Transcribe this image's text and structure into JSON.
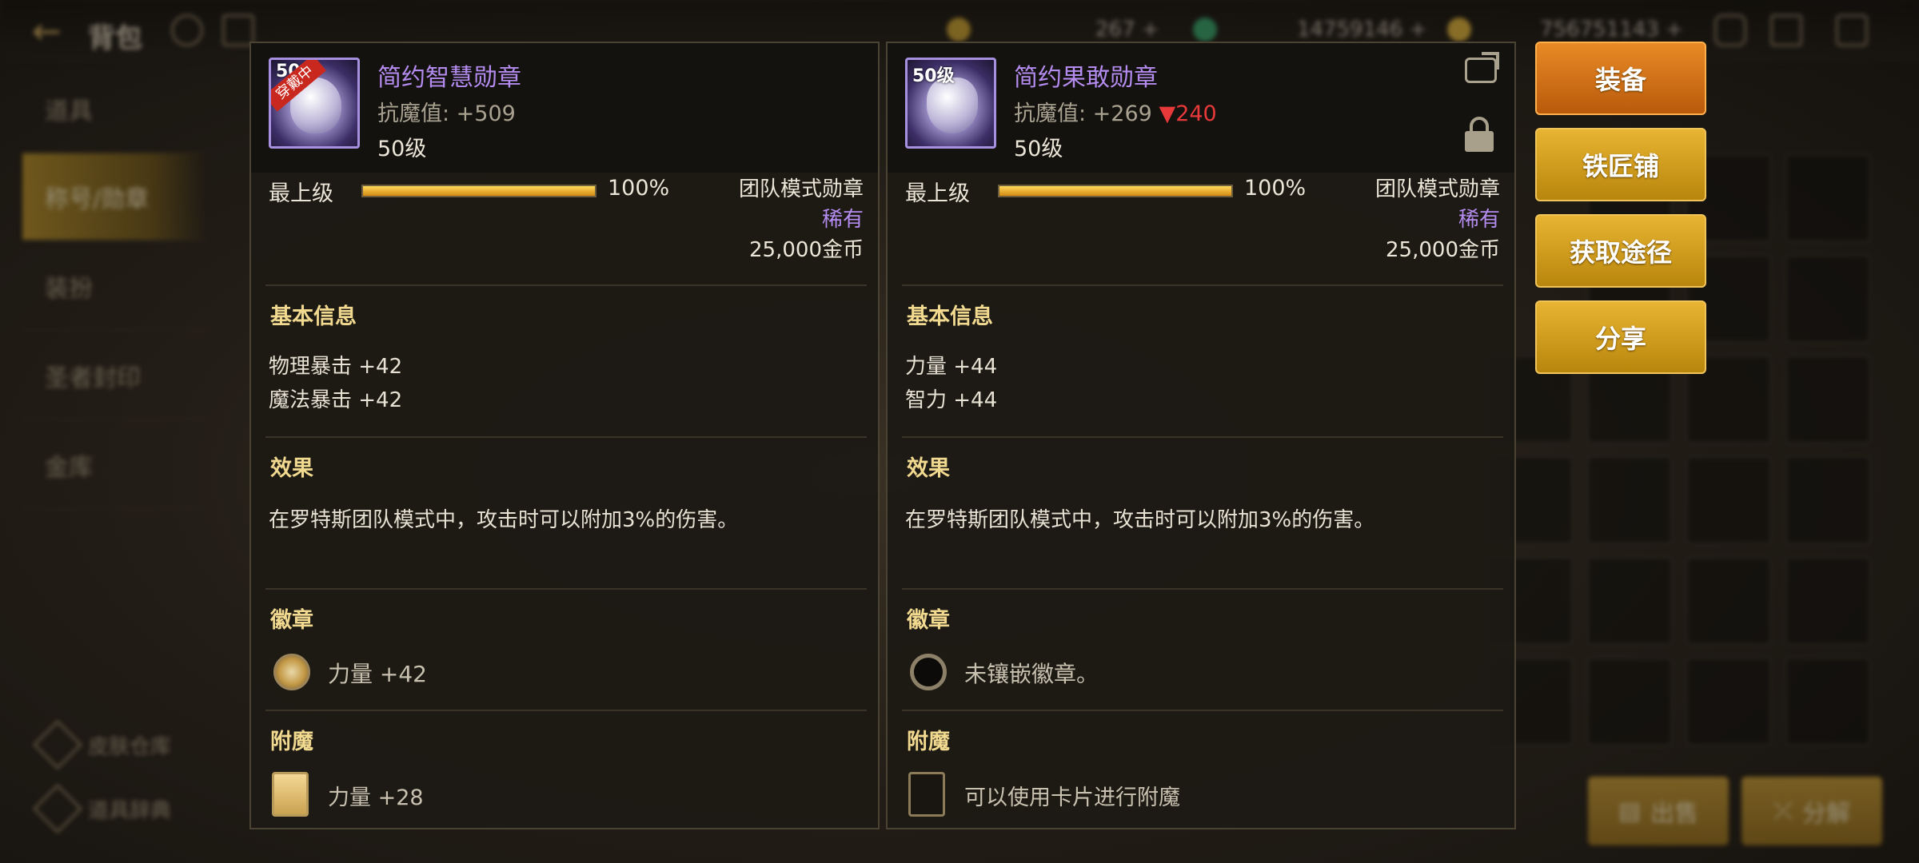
{
  "top_bar": {
    "back_label": "背包",
    "currency_1": "267 +",
    "currency_2": "14759146 +",
    "currency_3": "756751143 +"
  },
  "sidebar": {
    "items": [
      {
        "label": "道具"
      },
      {
        "label": "称号/勋章"
      },
      {
        "label": "装扮"
      },
      {
        "label": "圣者封印"
      },
      {
        "label": "金库"
      }
    ],
    "bottom": [
      {
        "label": "皮肤仓库"
      },
      {
        "label": "道具辞典"
      }
    ]
  },
  "bottom_buttons": {
    "sell": "出售",
    "decompose": "分解"
  },
  "panels": [
    {
      "name": "简约智慧勋章",
      "icon_level": "50",
      "equipped_tag": "穿戴中",
      "stat_label": "抗魔值: +509",
      "stat_diff": "",
      "level": "50级",
      "tier": "最上级",
      "progress_pct": "100%",
      "progress_value": 100,
      "mode": "团队模式勋章",
      "rarity": "稀有",
      "price": "25,000金币",
      "basic_title": "基本信息",
      "basic_lines": [
        "物理暴击 +42",
        "魔法暴击 +42"
      ],
      "effect_title": "效果",
      "effect_text": "在罗特斯团队模式中，攻击时可以附加3%的伤害。",
      "emblem_title": "徽章",
      "emblem_text": "力量 +42",
      "enchant_title": "附魔",
      "enchant_text": "力量 +28"
    },
    {
      "name": "简约果敢勋章",
      "icon_level": "50级",
      "equipped_tag": "",
      "stat_label": "抗魔值: +269",
      "stat_diff": "▼240",
      "level": "50级",
      "tier": "最上级",
      "progress_pct": "100%",
      "progress_value": 100,
      "mode": "团队模式勋章",
      "rarity": "稀有",
      "price": "25,000金币",
      "basic_title": "基本信息",
      "basic_lines": [
        "力量 +44",
        "智力 +44"
      ],
      "effect_title": "效果",
      "effect_text": "在罗特斯团队模式中，攻击时可以附加3%的伤害。",
      "emblem_title": "徽章",
      "emblem_text": "未镶嵌徽章。",
      "enchant_title": "附魔",
      "enchant_text": "可以使用卡片进行附魔"
    }
  ],
  "actions": {
    "equip": "装备",
    "blacksmith": "铁匠铺",
    "obtain": "获取途径",
    "share": "分享"
  },
  "colors": {
    "accent_orange": "#d9731a",
    "accent_gold": "#d8a22a",
    "rarity_purple": "#b48cf0",
    "section_title": "#f1d98f",
    "stat_down": "#e8393a"
  }
}
